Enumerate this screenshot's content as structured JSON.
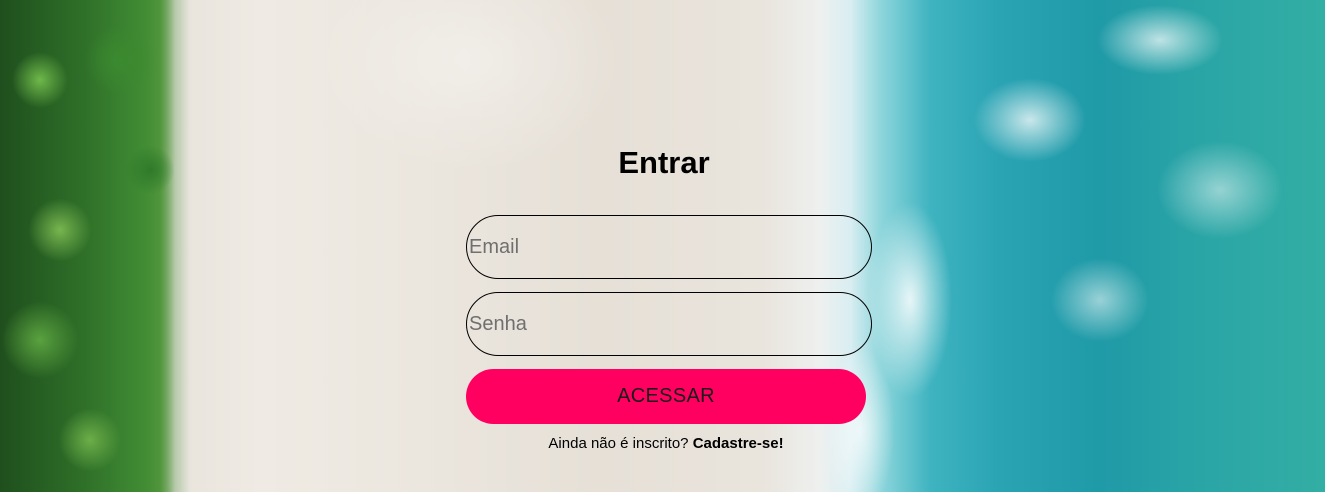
{
  "login": {
    "title": "Entrar",
    "email_placeholder": "Email",
    "password_placeholder": "Senha",
    "submit_label": "ACESSAR",
    "signup_prompt": "Ainda não é inscrito?",
    "signup_link": "Cadastre-se!"
  },
  "colors": {
    "button": "#ff0060"
  }
}
